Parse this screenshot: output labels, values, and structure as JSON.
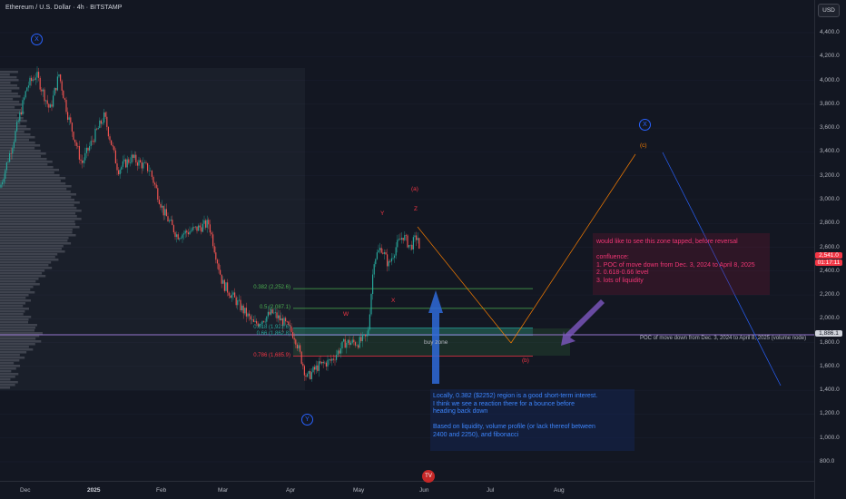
{
  "header": {
    "symbol_title": "Ethereum / U.S. Dollar · 4h · BITSTAMP",
    "currency_label": "USD"
  },
  "price_axis": {
    "ticks": [
      "4,400.0",
      "4,200.0",
      "4,000.0",
      "3,800.0",
      "3,600.0",
      "3,400.0",
      "3,200.0",
      "3,000.0",
      "2,800.0",
      "2,600.0",
      "2,400.0",
      "2,200.0",
      "2,000.0",
      "1,800.0",
      "1,600.0",
      "1,400.0",
      "1,200.0",
      "1,000.0",
      "800.0"
    ],
    "current_price": "2,541.0",
    "countdown": "01:17:11",
    "poc_price": "1,886.1"
  },
  "time_axis": {
    "ticks": [
      {
        "label": "Dec",
        "bold": false
      },
      {
        "label": "2025",
        "bold": true
      },
      {
        "label": "Feb",
        "bold": false
      },
      {
        "label": "Mar",
        "bold": false
      },
      {
        "label": "Apr",
        "bold": false
      },
      {
        "label": "May",
        "bold": false
      },
      {
        "label": "Jun",
        "bold": false
      },
      {
        "label": "Jul",
        "bold": false
      },
      {
        "label": "Aug",
        "bold": false
      }
    ]
  },
  "fib_levels": [
    {
      "label": "0.382 (2,252.6)",
      "price": 2252.6,
      "color": "#4caf50"
    },
    {
      "label": "0.5 (2,087.1)",
      "price": 2087.1,
      "color": "#4caf50"
    },
    {
      "label": "0.618 (1,921.6)",
      "price": 1921.6,
      "color": "#26a69a"
    },
    {
      "label": "0.66 (1,862.8)",
      "price": 1862.8,
      "color": "#26a69a"
    },
    {
      "label": "0.786 (1,685.9)",
      "price": 1685.9,
      "color": "#f23645"
    }
  ],
  "annotations": {
    "poc_line_label": "POC of move down from Dec. 3, 2024 to April 8, 2025 (volume node)",
    "buy_zone_label": "buy zone",
    "note_top": "would like to see this zone tapped, before reversal\n\nconfluence:\n1. POC of move down from Dec. 3, 2024 to April 8, 2025\n2. 0.618-0.66 level\n3. lots of liquidity",
    "note_bottom": "Locally, 0.382 ($2252) region is a good short-term interest.\nI think we see a reaction there for a bounce before\nheading back down\n\nBased on liquidity, volume profile (or lack thereof between\n2400 and 2250), and fibonacci"
  },
  "wave_labels": {
    "x_top_left": "X",
    "y_bottom": "Y",
    "x_top_right": "X",
    "a": "(a)",
    "b": "(b)",
    "c": "(c)",
    "w": "W",
    "x_mid": "X",
    "y_mid": "Y",
    "z": "Z"
  },
  "colors": {
    "background": "#131722",
    "up_candle": "#26a69a",
    "down_candle": "#ef5350",
    "accent_blue": "#2962ff",
    "accent_red": "#f23645",
    "accent_pink": "#f23675"
  },
  "logo_text": "TV"
}
